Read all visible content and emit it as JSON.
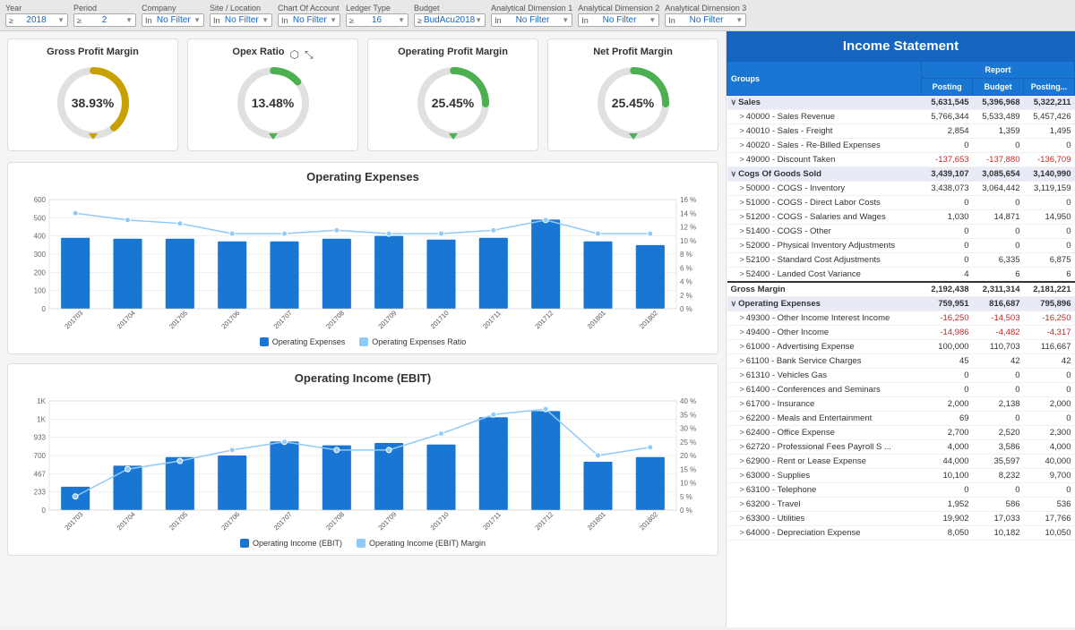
{
  "filters": [
    {
      "label": "Year",
      "prefix": "≥",
      "value": "2018"
    },
    {
      "label": "Period",
      "prefix": "≥",
      "value": "2"
    },
    {
      "label": "Company",
      "prefix": "In",
      "value": "No Filter"
    },
    {
      "label": "Site / Location",
      "prefix": "In",
      "value": "No Filter"
    },
    {
      "label": "Chart Of Account",
      "prefix": "In",
      "value": "No Filter"
    },
    {
      "label": "Ledger Type",
      "prefix": "≥",
      "value": "16"
    },
    {
      "label": "Budget",
      "prefix": "≥",
      "value": "BudAcu2018"
    },
    {
      "label": "Analytical Dimension 1",
      "prefix": "In",
      "value": "No Filter"
    },
    {
      "label": "Analytical Dimension 2",
      "prefix": "In",
      "value": "No Filter"
    },
    {
      "label": "Analytical Dimension 3",
      "prefix": "In",
      "value": "No Filter"
    }
  ],
  "kpis": [
    {
      "title": "Gross Profit Margin",
      "value": "38.93%",
      "color": "#c8a000",
      "pct": 38.93
    },
    {
      "title": "Opex Ratio",
      "value": "13.48%",
      "color": "#4caf50",
      "pct": 13.48
    },
    {
      "title": "Operating Profit Margin",
      "value": "25.45%",
      "color": "#4caf50",
      "pct": 25.45
    },
    {
      "title": "Net Profit Margin",
      "value": "25.45%",
      "color": "#4caf50",
      "pct": 25.45
    }
  ],
  "opex_chart": {
    "title": "Operating Expenses",
    "periods": [
      "201703",
      "201704",
      "201705",
      "201706",
      "201707",
      "201708",
      "201709",
      "201710",
      "201711",
      "201712",
      "201801",
      "201802"
    ],
    "bars": [
      390,
      385,
      385,
      370,
      370,
      385,
      400,
      380,
      390,
      490,
      370,
      350
    ],
    "line": [
      14,
      13,
      12.5,
      11,
      11,
      11.5,
      11,
      11,
      11.5,
      13,
      11,
      11
    ],
    "legend": [
      "Operating Expenses",
      "Operating Expenses Ratio"
    ],
    "colors": [
      "#1976d2",
      "#90caf9"
    ],
    "ymax": 600,
    "y2max": 16
  },
  "ebit_chart": {
    "title": "Operating Income (EBIT)",
    "periods": [
      "201703",
      "201704",
      "201705",
      "201706",
      "201707",
      "201708",
      "201709",
      "201710",
      "201711",
      "201712",
      "201801",
      "201802"
    ],
    "bars": [
      300,
      570,
      680,
      700,
      880,
      830,
      860,
      840,
      1190,
      1270,
      620,
      680
    ],
    "line": [
      5,
      15,
      18,
      22,
      25,
      22,
      22,
      28,
      35,
      37,
      20,
      23
    ],
    "legend": [
      "Operating Income (EBIT)",
      "Operating Income (EBIT) Margin"
    ],
    "colors": [
      "#1976d2",
      "#90caf9"
    ],
    "ymax": 1400,
    "y2max": 40
  },
  "income_statement": {
    "title": "Income Statement",
    "col_headers": [
      "Groups",
      "Posting",
      "Budget",
      "Posting..."
    ],
    "rows": [
      {
        "type": "section",
        "indent": 0,
        "expand": true,
        "label": "Sales",
        "c1": "5,631,545",
        "c2": "5,396,968",
        "c3": "5,322,211"
      },
      {
        "type": "data",
        "indent": 1,
        "expand": true,
        "label": "40000 - Sales Revenue",
        "c1": "5,766,344",
        "c2": "5,533,489",
        "c3": "5,457,426"
      },
      {
        "type": "data",
        "indent": 1,
        "expand": true,
        "label": "40010 - Sales - Freight",
        "c1": "2,854",
        "c2": "1,359",
        "c3": "1,495"
      },
      {
        "type": "data",
        "indent": 1,
        "expand": true,
        "label": "40020 - Sales - Re-Billed Expenses",
        "c1": "0",
        "c2": "0",
        "c3": "0"
      },
      {
        "type": "data",
        "indent": 1,
        "expand": true,
        "label": "49000 - Discount Taken",
        "c1": "-137,653",
        "c2": "-137,880",
        "c3": "-136,709",
        "neg1": true,
        "neg2": true,
        "neg3": true
      },
      {
        "type": "section",
        "indent": 0,
        "expand": true,
        "label": "Cogs Of Goods Sold",
        "c1": "3,439,107",
        "c2": "3,085,654",
        "c3": "3,140,990"
      },
      {
        "type": "data",
        "indent": 1,
        "expand": true,
        "label": "50000 - COGS - Inventory",
        "c1": "3,438,073",
        "c2": "3,064,442",
        "c3": "3,119,159"
      },
      {
        "type": "data",
        "indent": 1,
        "expand": true,
        "label": "51000 - COGS - Direct Labor Costs",
        "c1": "0",
        "c2": "0",
        "c3": "0"
      },
      {
        "type": "data",
        "indent": 1,
        "expand": true,
        "label": "51200 - COGS - Salaries and Wages",
        "c1": "1,030",
        "c2": "14,871",
        "c3": "14,950"
      },
      {
        "type": "data",
        "indent": 1,
        "expand": true,
        "label": "51400 - COGS - Other",
        "c1": "0",
        "c2": "0",
        "c3": "0"
      },
      {
        "type": "data",
        "indent": 1,
        "expand": true,
        "label": "52000 - Physical Inventory Adjustments",
        "c1": "0",
        "c2": "0",
        "c3": "0"
      },
      {
        "type": "data",
        "indent": 1,
        "expand": true,
        "label": "52100 - Standard Cost Adjustments",
        "c1": "0",
        "c2": "6,335",
        "c3": "6,875"
      },
      {
        "type": "data",
        "indent": 1,
        "expand": true,
        "label": "52400 - Landed Cost Variance",
        "c1": "4",
        "c2": "6",
        "c3": "6"
      },
      {
        "type": "gross",
        "indent": 0,
        "label": "Gross Margin",
        "c1": "2,192,438",
        "c2": "2,311,314",
        "c3": "2,181,221"
      },
      {
        "type": "section",
        "indent": 0,
        "expand": true,
        "label": "Operating Expenses",
        "c1": "759,951",
        "c2": "816,687",
        "c3": "795,896"
      },
      {
        "type": "data",
        "indent": 1,
        "expand": true,
        "label": "49300 - Other Income Interest Income",
        "c1": "-16,250",
        "c2": "-14,503",
        "c3": "-16,250",
        "neg1": true,
        "neg2": true,
        "neg3": true
      },
      {
        "type": "data",
        "indent": 1,
        "expand": true,
        "label": "49400 - Other Income",
        "c1": "-14,986",
        "c2": "-4,482",
        "c3": "-4,317",
        "neg1": true,
        "neg2": true,
        "neg3": true
      },
      {
        "type": "data",
        "indent": 1,
        "expand": true,
        "label": "61000 - Advertising Expense",
        "c1": "100,000",
        "c2": "110,703",
        "c3": "116,667"
      },
      {
        "type": "data",
        "indent": 1,
        "expand": true,
        "label": "61100 - Bank Service Charges",
        "c1": "45",
        "c2": "42",
        "c3": "42"
      },
      {
        "type": "data",
        "indent": 1,
        "expand": true,
        "label": "61310 - Vehicles Gas",
        "c1": "0",
        "c2": "0",
        "c3": "0"
      },
      {
        "type": "data",
        "indent": 1,
        "expand": true,
        "label": "61400 - Conferences and Seminars",
        "c1": "0",
        "c2": "0",
        "c3": "0"
      },
      {
        "type": "data",
        "indent": 1,
        "expand": true,
        "label": "61700 - Insurance",
        "c1": "2,000",
        "c2": "2,138",
        "c3": "2,000"
      },
      {
        "type": "data",
        "indent": 1,
        "expand": true,
        "label": "62200 - Meals and Entertainment",
        "c1": "69",
        "c2": "0",
        "c3": "0"
      },
      {
        "type": "data",
        "indent": 1,
        "expand": true,
        "label": "62400 - Office Expense",
        "c1": "2,700",
        "c2": "2,520",
        "c3": "2,300"
      },
      {
        "type": "data",
        "indent": 1,
        "expand": true,
        "label": "62720 - Professional Fees Payroll S ...",
        "c1": "4,000",
        "c2": "3,586",
        "c3": "4,000"
      },
      {
        "type": "data",
        "indent": 1,
        "expand": true,
        "label": "62900 - Rent or Lease Expense",
        "c1": "44,000",
        "c2": "35,597",
        "c3": "40,000"
      },
      {
        "type": "data",
        "indent": 1,
        "expand": true,
        "label": "63000 - Supplies",
        "c1": "10,100",
        "c2": "8,232",
        "c3": "9,700"
      },
      {
        "type": "data",
        "indent": 1,
        "expand": true,
        "label": "63100 - Telephone",
        "c1": "0",
        "c2": "0",
        "c3": "0"
      },
      {
        "type": "data",
        "indent": 1,
        "expand": true,
        "label": "63200 - Travel",
        "c1": "1,952",
        "c2": "586",
        "c3": "536"
      },
      {
        "type": "data",
        "indent": 1,
        "expand": true,
        "label": "63300 - Utilities",
        "c1": "19,902",
        "c2": "17,033",
        "c3": "17,766"
      },
      {
        "type": "data",
        "indent": 1,
        "expand": true,
        "label": "64000 - Depreciation Expense",
        "c1": "8,050",
        "c2": "10,182",
        "c3": "10,050"
      }
    ]
  }
}
